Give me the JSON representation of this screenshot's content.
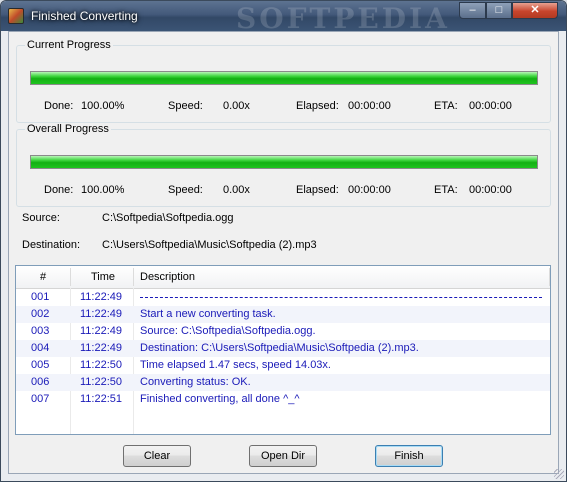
{
  "window": {
    "title": "Finished Converting",
    "watermark": "SOFTPEDIA",
    "controls": {
      "minimize": "–",
      "maximize": "□",
      "close": "✕"
    }
  },
  "current_progress": {
    "title": "Current Progress",
    "fraction": 1.0,
    "done_label": "Done:",
    "done_value": "100.00%",
    "speed_label": "Speed:",
    "speed_value": "0.00x",
    "elapsed_label": "Elapsed:",
    "elapsed_value": "00:00:00",
    "eta_label": "ETA:",
    "eta_value": "00:00:00"
  },
  "overall_progress": {
    "title": "Overall Progress",
    "fraction": 1.0,
    "done_label": "Done:",
    "done_value": "100.00%",
    "speed_label": "Speed:",
    "speed_value": "0.00x",
    "elapsed_label": "Elapsed:",
    "elapsed_value": "00:00:00",
    "eta_label": "ETA:",
    "eta_value": "00:00:00"
  },
  "source": {
    "label": "Source:",
    "value": "C:\\Softpedia\\Softpedia.ogg"
  },
  "destination": {
    "label": "Destination:",
    "value": "C:\\Users\\Softpedia\\Music\\Softpedia (2).mp3"
  },
  "log": {
    "columns": [
      "#",
      "Time",
      "Description"
    ],
    "rows": [
      {
        "num": "001",
        "time": "11:22:49",
        "desc": ""
      },
      {
        "num": "002",
        "time": "11:22:49",
        "desc": "Start a new converting task."
      },
      {
        "num": "003",
        "time": "11:22:49",
        "desc": "Source:  C:\\Softpedia\\Softpedia.ogg."
      },
      {
        "num": "004",
        "time": "11:22:49",
        "desc": "Destination: C:\\Users\\Softpedia\\Music\\Softpedia (2).mp3."
      },
      {
        "num": "005",
        "time": "11:22:50",
        "desc": "Time elapsed 1.47 secs, speed 14.03x."
      },
      {
        "num": "006",
        "time": "11:22:50",
        "desc": "Converting status: OK."
      },
      {
        "num": "007",
        "time": "11:22:51",
        "desc": "Finished converting, all done ^_^"
      }
    ]
  },
  "buttons": {
    "clear": "Clear",
    "open_dir": "Open Dir",
    "finish": "Finish"
  },
  "colors": {
    "progress_fill": "#1fc41f",
    "log_text": "#1a1ab8",
    "title_bar": "#43597a"
  }
}
